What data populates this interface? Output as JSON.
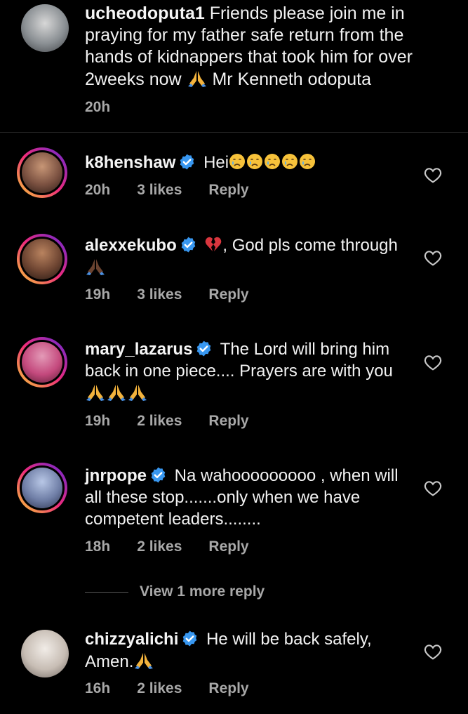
{
  "caption": {
    "username": "ucheodoputa1",
    "text_part1": " Friends please join me in praying for my father safe return from the hands of kidnappers that took him for over 2weeks now ",
    "text_part2": " Mr Kenneth odoputa",
    "time": "20h"
  },
  "comments": [
    {
      "username": "k8henshaw",
      "verified": true,
      "text": "Hei",
      "time": "20h",
      "likes": "3 likes",
      "reply": "Reply"
    },
    {
      "username": "alexxekubo",
      "verified": true,
      "text": ", God pls come through",
      "time": "19h",
      "likes": "3 likes",
      "reply": "Reply"
    },
    {
      "username": "mary_lazarus",
      "verified": true,
      "text": "The Lord will bring him back in one piece.... Prayers are with you",
      "time": "19h",
      "likes": "2 likes",
      "reply": "Reply"
    },
    {
      "username": "jnrpope",
      "verified": true,
      "text": "Na wahooooooooo , when will all these stop.......only when we have competent leaders........",
      "time": "18h",
      "likes": "2 likes",
      "reply": "Reply",
      "view_more": "View 1 more reply"
    },
    {
      "username": "chizzyalichi",
      "verified": true,
      "text": "He will be back safely, Amen.",
      "time": "16h",
      "likes": "2 likes",
      "reply": "Reply"
    }
  ],
  "colors": {
    "background": "#000000",
    "text": "#f2f2f2",
    "meta": "#a8a8a8",
    "verified_blue": "#3897f0",
    "divider": "#262626"
  },
  "icons": {
    "like": "heart-outline-icon",
    "verified": "verified-badge-icon",
    "pray": "folded-hands-emoji",
    "cry": "crying-face-emoji",
    "broken_heart": "broken-heart-emoji"
  }
}
